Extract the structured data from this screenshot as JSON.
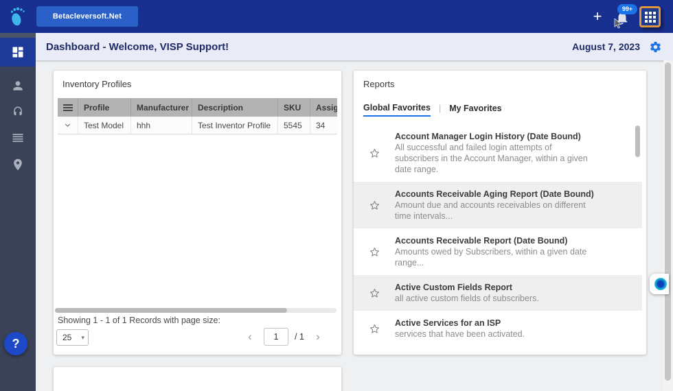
{
  "topbar": {
    "brand_label": "Betacleversoft.Net",
    "notification_badge": "99+"
  },
  "header": {
    "title": "Dashboard - Welcome, VISP Support!",
    "date": "August 7, 2023"
  },
  "inventory": {
    "title": "Inventory Profiles",
    "table": {
      "headers": [
        "Profile",
        "Manufacturer",
        "Description",
        "SKU",
        "Assigned"
      ],
      "rows": [
        [
          "Test Model",
          "hhh",
          "Test Inventor Profile",
          "5545",
          "34"
        ]
      ]
    },
    "footer": {
      "showing_text": "Showing 1 - 1 of 1 Records with page size:",
      "page_size": "25",
      "current_page": "1",
      "total_pages": "/ 1"
    }
  },
  "reports": {
    "title": "Reports",
    "tab_separator": "|",
    "tabs": [
      {
        "label": "Global Favorites",
        "active": true
      },
      {
        "label": "My Favorites",
        "active": false
      }
    ],
    "items": [
      {
        "title": "Account Manager Login History (Date Bound)",
        "description": "All successful and failed login attempts of subscribers in the Account Manager, within a given date range."
      },
      {
        "title": "Accounts Receivable Aging Report (Date Bound)",
        "description": "Amount due and accounts receivables on different time intervals..."
      },
      {
        "title": "Accounts Receivable Report (Date Bound)",
        "description": "Amounts owed by Subscribers, within a given date range..."
      },
      {
        "title": "Active Custom Fields Report",
        "description": "all active custom fields of subscribers."
      },
      {
        "title": "Active Services for an ISP",
        "description": "services that have been activated."
      }
    ]
  },
  "help": {
    "label": "?"
  },
  "colors": {
    "topbar": "#172f8e",
    "accent_blue": "#1a73e8",
    "sidebar": "#3a4257",
    "active_nav": "#1d3a99",
    "header_bg": "#e9ebf7",
    "apps_button_border": "#e0953f",
    "table_header_bg": "#b3b3b3"
  }
}
